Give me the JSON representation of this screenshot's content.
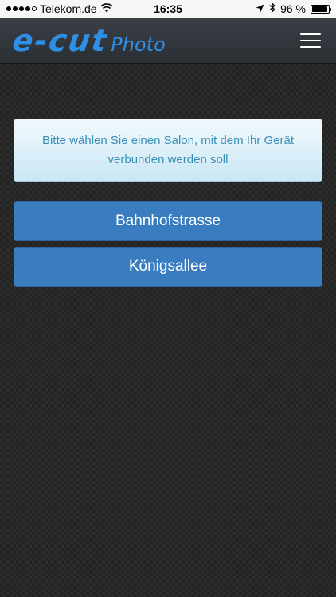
{
  "status_bar": {
    "carrier": "Telekom.de",
    "time": "16:35",
    "battery": "96 %",
    "battery_level": 0.96,
    "icons": [
      "signal-dots",
      "wifi-icon",
      "location-arrow-icon",
      "bluetooth-icon",
      "battery-icon"
    ]
  },
  "header": {
    "logo_main": "e-cut",
    "logo_sub": "Photo",
    "menu_icon": "hamburger-menu-icon"
  },
  "info": {
    "message": "Bitte wählen Sie einen Salon, mit dem Ihr Gerät verbunden werden soll"
  },
  "salons": [
    {
      "label": "Bahnhofstrasse"
    },
    {
      "label": "Königsallee"
    }
  ],
  "colors": {
    "accent": "#2f8ee6",
    "button": "#3a7cc0",
    "info_text": "#3a8fb6"
  }
}
